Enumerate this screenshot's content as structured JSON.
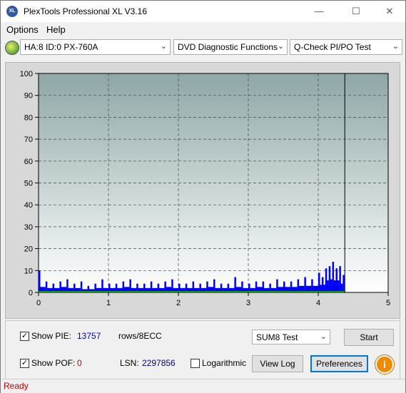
{
  "window": {
    "title": "PlexTools Professional XL V3.16",
    "app_icon_text": "XL"
  },
  "controls": {
    "minimize": "—",
    "maximize": "☐",
    "close": "✕"
  },
  "menu": [
    {
      "label": "Options"
    },
    {
      "label": "Help"
    }
  ],
  "toolbar": {
    "drive": "HA:8 ID:0  PX-760A",
    "function": "DVD Diagnostic Functions",
    "test": "Q-Check PI/PO Test"
  },
  "chart_data": {
    "type": "bar",
    "x_ticks": [
      "0",
      "1",
      "2",
      "3",
      "4",
      "5"
    ],
    "y_ticks": [
      "0",
      "10",
      "20",
      "30",
      "40",
      "50",
      "60",
      "70",
      "80",
      "90",
      "100"
    ],
    "xlim": [
      0,
      5
    ],
    "ylim": [
      0,
      100
    ],
    "grid": true,
    "end_marker_x": 4.38,
    "series": [
      {
        "color": "#0000ff",
        "x": [
          0.0,
          0.1,
          0.2,
          0.3,
          0.4,
          0.5,
          0.6,
          0.7,
          0.8,
          0.9,
          1.0,
          1.1,
          1.2,
          1.3,
          1.4,
          1.5,
          1.6,
          1.7,
          1.8,
          1.9,
          2.0,
          2.1,
          2.2,
          2.3,
          2.4,
          2.5,
          2.6,
          2.7,
          2.8,
          2.9,
          3.0,
          3.1,
          3.2,
          3.3,
          3.4,
          3.5,
          3.6,
          3.7,
          3.8,
          3.9,
          4.0,
          4.05,
          4.1,
          4.15,
          4.2,
          4.25,
          4.3,
          4.35
        ],
        "values": [
          10,
          5,
          4,
          5,
          6,
          4,
          5,
          3,
          4,
          6,
          4,
          4,
          5,
          6,
          4,
          4,
          5,
          4,
          5,
          6,
          4,
          4,
          5,
          4,
          5,
          6,
          4,
          4,
          7,
          5,
          4,
          5,
          5,
          4,
          6,
          5,
          5,
          6,
          7,
          6,
          9,
          7,
          11,
          12,
          14,
          11,
          12,
          8
        ]
      },
      {
        "color": "#00a000",
        "x": [
          0.0,
          4.38
        ],
        "values": [
          0,
          0
        ]
      }
    ]
  },
  "bottom": {
    "show_pie_label": "Show PIE:",
    "pie_value": "13757",
    "rows_label": "rows/8ECC",
    "show_pof_label": "Show POF:",
    "pof_value": "0",
    "lsn_label": "LSN:",
    "lsn_value": "2297856",
    "logarithmic_label": "Logarithmic",
    "sum8_select": "SUM8 Test",
    "start_button": "Start",
    "view_log_button": "View Log",
    "preferences_button": "Preferences",
    "info_button": "i",
    "checkmark": "✓",
    "pie_checked": true,
    "pof_checked": true,
    "log_checked": false
  },
  "colors": {
    "plot_bg_top": "#8fa7a7",
    "plot_bg_bottom": "#ffffff",
    "pie_value": "#0000c0",
    "pof_value": "#c00000",
    "status": "#c00000"
  },
  "status": {
    "text": "Ready"
  }
}
